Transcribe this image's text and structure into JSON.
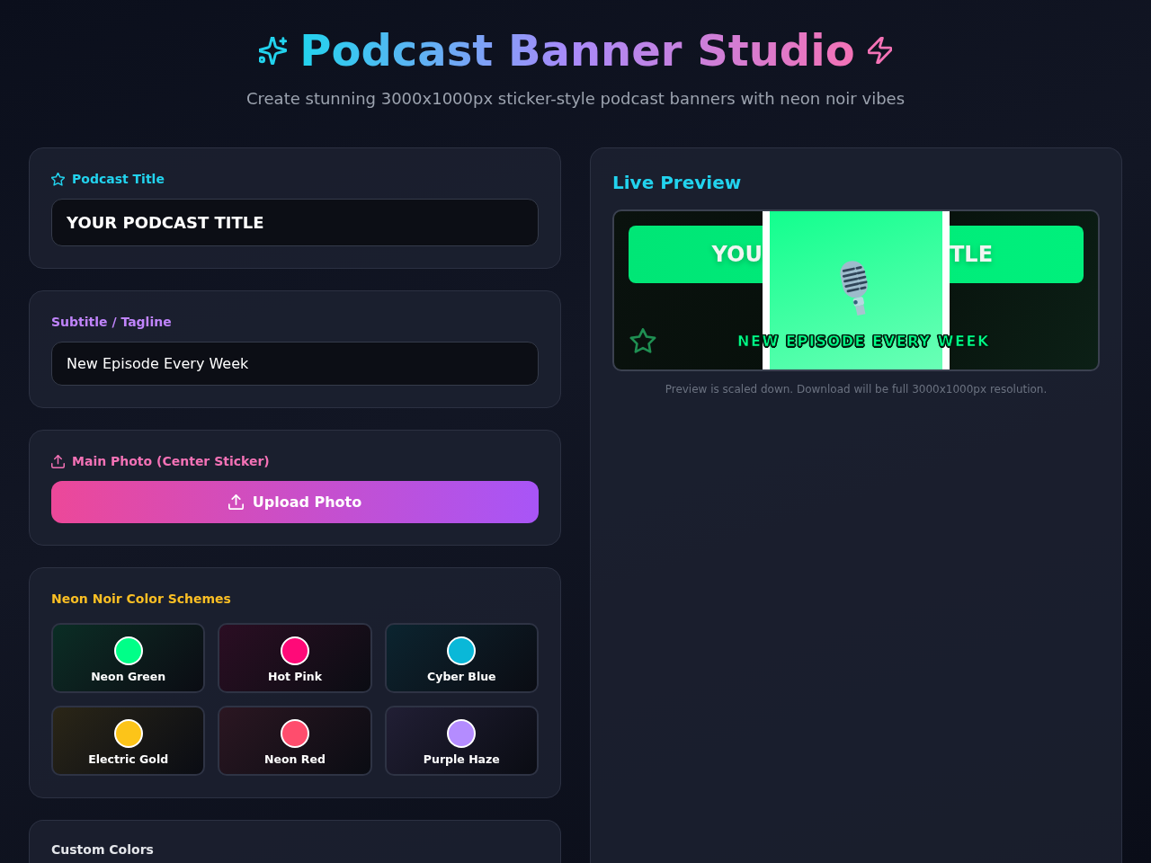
{
  "header": {
    "title": "Podcast Banner Studio",
    "subtitle": "Create stunning 3000x1000px sticker-style podcast banners with neon noir vibes"
  },
  "editor": {
    "title_field": {
      "label": "Podcast Title",
      "value": "YOUR PODCAST TITLE"
    },
    "subtitle_field": {
      "label": "Subtitle / Tagline",
      "value": "New Episode Every Week"
    },
    "photo": {
      "label": "Main Photo (Center Sticker)",
      "button": "Upload Photo"
    },
    "schemes": {
      "label": "Neon Noir Color Schemes",
      "items": [
        {
          "name": "Neon Green",
          "color": "#00ff88"
        },
        {
          "name": "Hot Pink",
          "color": "#ff0a78"
        },
        {
          "name": "Cyber Blue",
          "color": "#0ab8d8"
        },
        {
          "name": "Electric Gold",
          "color": "#fcc419"
        },
        {
          "name": "Neon Red",
          "color": "#ff4d6d"
        },
        {
          "name": "Purple Haze",
          "color": "#b48cff"
        }
      ]
    },
    "custom_colors": {
      "label": "Custom Colors"
    }
  },
  "preview": {
    "heading": "Live Preview",
    "banner": {
      "title_left": "YOU",
      "title_right": "TLE",
      "subtitle": "NEW EPISODE EVERY WEEK"
    },
    "note": "Preview is scaled down. Download will be full 3000x1000px resolution."
  }
}
